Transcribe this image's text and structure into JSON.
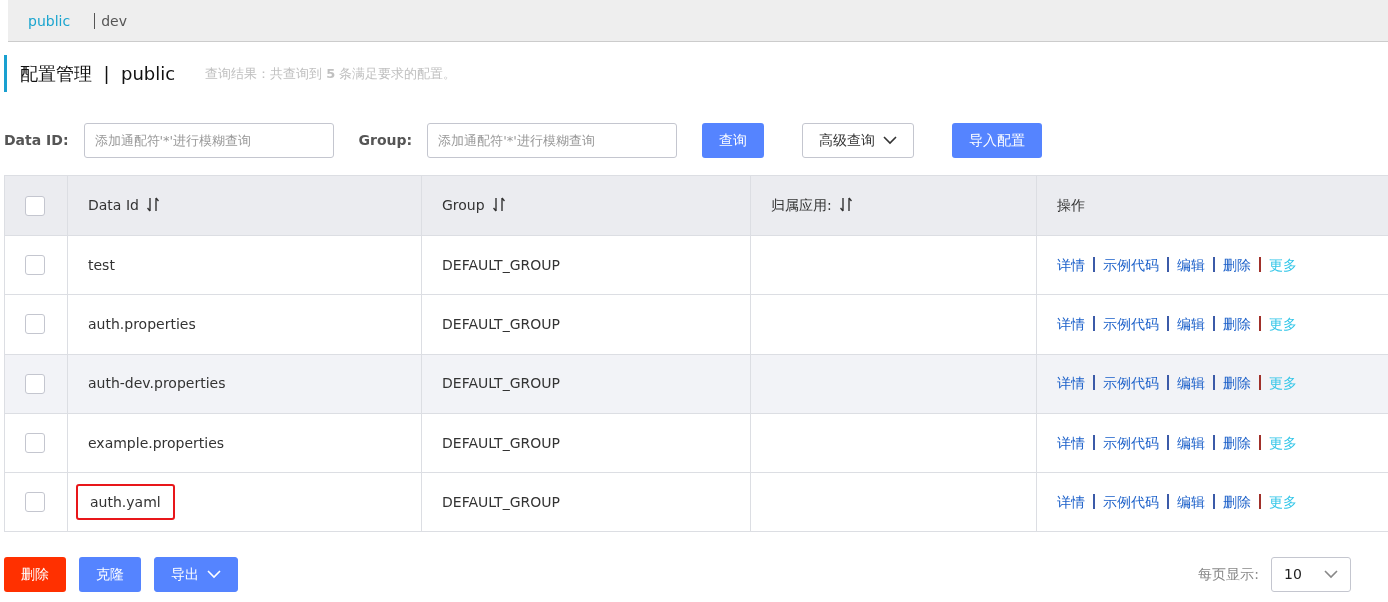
{
  "namespaces": [
    {
      "label": "public",
      "selected": true
    },
    {
      "label": "dev",
      "selected": false
    }
  ],
  "page_title": {
    "title": "配置管理",
    "separator": "|",
    "namespace": "public"
  },
  "result_text": "查询结果：共查询到 **5** 条满足要求的配置。",
  "filters": [
    {
      "label": "Data ID:",
      "placeholder": "添加通配符'*'进行模糊查询"
    },
    {
      "label": "Group:",
      "placeholder": "添加通配符'*'进行模糊查询"
    }
  ],
  "toolbar_buttons": [
    {
      "label": "查询",
      "kind": "primary"
    },
    {
      "label": "高级查询",
      "kind": "dropdown"
    },
    {
      "label": "导入配置",
      "kind": "primary"
    }
  ],
  "table": {
    "select_all_checked": false,
    "columns": [
      {
        "label": "Data Id",
        "sortable": true
      },
      {
        "label": "Group",
        "sortable": true
      },
      {
        "label": "归属应用:",
        "sortable": true
      },
      {
        "label": "操作",
        "sortable": false
      }
    ],
    "rows": [
      {
        "checked": false,
        "hovered": false,
        "highlighted": false,
        "data_id": "test",
        "group": "DEFAULT_GROUP",
        "actions": [
          {
            "label": "详情",
            "kind": "link"
          },
          {
            "label": "示例代码",
            "kind": "link"
          },
          {
            "label": "编辑",
            "kind": "link"
          },
          {
            "label": "删除",
            "kind": "link"
          },
          {
            "label": "更多",
            "kind": "more"
          }
        ]
      },
      {
        "checked": false,
        "hovered": false,
        "highlighted": false,
        "data_id": "auth.properties",
        "group": "DEFAULT_GROUP",
        "actions": [
          {
            "label": "详情",
            "kind": "link"
          },
          {
            "label": "示例代码",
            "kind": "link"
          },
          {
            "label": "编辑",
            "kind": "link"
          },
          {
            "label": "删除",
            "kind": "link"
          },
          {
            "label": "更多",
            "kind": "more"
          }
        ]
      },
      {
        "checked": false,
        "hovered": true,
        "highlighted": false,
        "data_id": "auth-dev.properties",
        "group": "DEFAULT_GROUP",
        "actions": [
          {
            "label": "详情",
            "kind": "link"
          },
          {
            "label": "示例代码",
            "kind": "link"
          },
          {
            "label": "编辑",
            "kind": "link"
          },
          {
            "label": "删除",
            "kind": "link"
          },
          {
            "label": "更多",
            "kind": "more"
          }
        ]
      },
      {
        "checked": false,
        "hovered": false,
        "highlighted": false,
        "data_id": "example.properties",
        "group": "DEFAULT_GROUP",
        "actions": [
          {
            "label": "详情",
            "kind": "link"
          },
          {
            "label": "示例代码",
            "kind": "link"
          },
          {
            "label": "编辑",
            "kind": "link"
          },
          {
            "label": "删除",
            "kind": "link"
          },
          {
            "label": "更多",
            "kind": "more"
          }
        ]
      },
      {
        "checked": false,
        "hovered": false,
        "highlighted": true,
        "data_id": "auth.yaml",
        "group": "DEFAULT_GROUP",
        "actions": [
          {
            "label": "详情",
            "kind": "link"
          },
          {
            "label": "示例代码",
            "kind": "link"
          },
          {
            "label": "编辑",
            "kind": "link"
          },
          {
            "label": "删除",
            "kind": "link"
          },
          {
            "label": "更多",
            "kind": "more"
          }
        ]
      }
    ]
  },
  "bottom_buttons": [
    {
      "label": "删除",
      "kind": "danger"
    },
    {
      "label": "克隆",
      "kind": "primary"
    },
    {
      "label": "导出",
      "kind": "dropdown"
    }
  ],
  "page_size": {
    "label": "每页显示:",
    "value": "10"
  }
}
